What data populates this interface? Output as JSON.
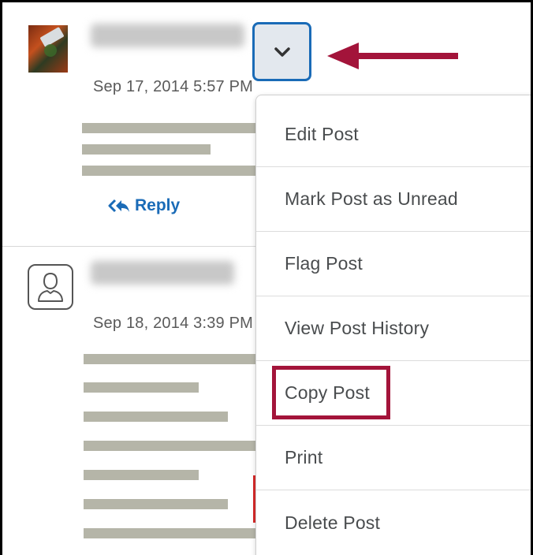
{
  "post1": {
    "timestamp": "Sep 17, 2014 5:57 PM",
    "reply_label": "Reply"
  },
  "post2": {
    "timestamp": "Sep 18, 2014 3:39 PM"
  },
  "context_menu": {
    "items": [
      {
        "label": "Edit Post"
      },
      {
        "label": "Mark Post as Unread"
      },
      {
        "label": "Flag Post"
      },
      {
        "label": "View Post History"
      },
      {
        "label": "Copy Post"
      },
      {
        "label": "Print"
      },
      {
        "label": "Delete Post"
      }
    ],
    "highlighted_item": "Copy Post"
  },
  "colors": {
    "accent": "#1a6bb7",
    "annotation": "#a3143a",
    "menu_text": "#494c4e"
  },
  "icons": [
    "chevron-down-icon",
    "reply-all-icon",
    "user-placeholder-icon",
    "pointer-arrow-icon"
  ]
}
